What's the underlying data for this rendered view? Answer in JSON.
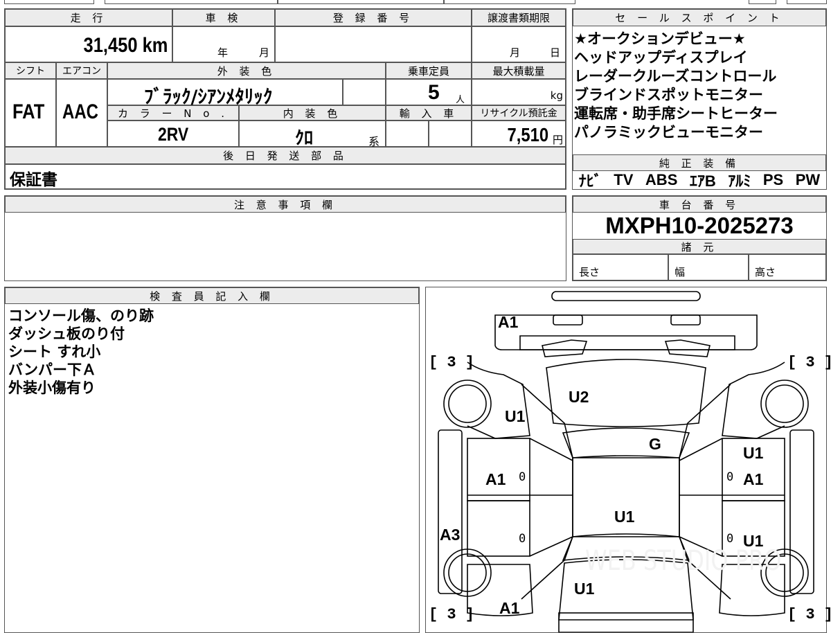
{
  "headers": {
    "mileage": "走 行",
    "inspection": "車 検",
    "registration": "登 録 番 号",
    "transfer_deadline": "譲渡書類期限",
    "sales_points": "セ ー ル ス ポ イ ン ト",
    "shift": "シフト",
    "aircon": "エアコン",
    "exterior_color": "外 装 色",
    "capacity": "乗車定員",
    "max_load": "最大積載量",
    "color_no": "カ ラ ー N o .",
    "interior_color": "内 装 色",
    "import": "輸 入 車",
    "recycle": "リサイクル預託金",
    "later_parts": "後 日 発 送 部 品",
    "genuine_equipment": "純 正 装 備",
    "notes": "注 意 事 項 欄",
    "chassis_number": "車 台 番 号",
    "specs": "諸 元",
    "inspector": "検 査 員 記 入 欄"
  },
  "vehicle": {
    "mileage": "31,450 km",
    "inspection_year": "年",
    "inspection_month": "月",
    "deadline_month": "月",
    "deadline_day": "日",
    "shift": "FAT",
    "aircon": "AAC",
    "exterior_color": "ﾌﾞﾗｯｸ/ｼｱﾝﾒﾀﾘｯｸ",
    "capacity": "5",
    "capacity_unit": "人",
    "max_load_unit": "kg",
    "color_no": "2RV",
    "interior_color": "ｸﾛ",
    "interior_suffix": "系",
    "recycle_fee": "7,510",
    "recycle_unit": "円",
    "later_parts": "保証書",
    "chassis_number": "MXPH10-2025273",
    "spec_length": "長さ",
    "spec_width": "幅",
    "spec_height": "高さ"
  },
  "sales_points": [
    "★オークションデビュー★",
    "ヘッドアップディスプレイ",
    "レーダークルーズコントロール",
    "ブラインドスポットモニター",
    "運転席・助手席シートヒーター",
    "パノラミックビューモニター"
  ],
  "equipment": [
    "ﾅﾋﾞ",
    "TV",
    "ABS",
    "ｴｱB",
    "ｱﾙﾐ",
    "PS",
    "PW"
  ],
  "inspector_notes": [
    "コンソール傷、のり跡",
    "ダッシュ板のり付",
    "シート すれ小",
    "バンパー下Ａ",
    "外装小傷有り"
  ],
  "damage_map": {
    "front_bumper": "A1",
    "hood": "U2",
    "left_front_fender": "U1",
    "windshield": "G",
    "right_front_fender": "U1",
    "left_front_door": "A1",
    "right_front_door": "A1",
    "roof": "U1",
    "left_side_sill": "A3",
    "right_rear_door": "U1",
    "trunk": "U1",
    "rear_bumper": "A1",
    "tire_fl": "3",
    "tire_fr": "3",
    "tire_rl": "3",
    "tire_rr": "3",
    "zero": "0"
  },
  "watermark": "WEB STUDIO PRO"
}
